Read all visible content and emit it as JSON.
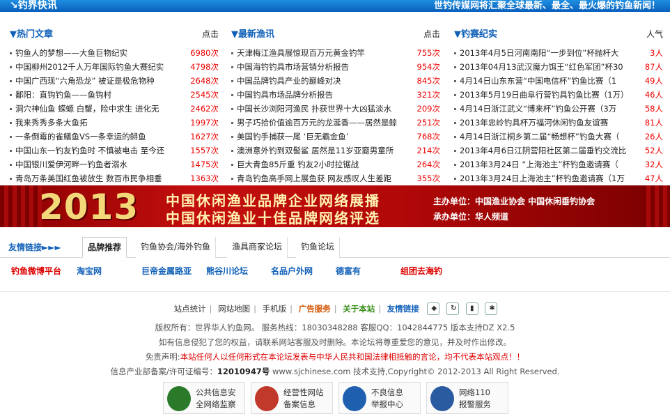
{
  "topbar": {
    "title": "↘钓界快讯",
    "slogan": "世钓传媒网将汇聚全球最新、最全、最火爆的钓鱼新闻！"
  },
  "cols": [
    {
      "heading": "▼热门文章",
      "count_label": "点击",
      "items": [
        {
          "t": "钓鱼人的梦想——大鱼巨物纪实",
          "n": "6980次"
        },
        {
          "t": "中国柳州2012千人万年国际钓鱼大赛纪实",
          "n": "4798次"
        },
        {
          "t": "中国广西现“六角恐龙” 被证是极危物种",
          "n": "2648次"
        },
        {
          "t": "鄱阳：直钩钓鱼——鱼钩村",
          "n": "2545次"
        },
        {
          "t": "洞穴神仙鱼 蝾螈 白蟹，险中求生 进化无",
          "n": "2462次"
        },
        {
          "t": "我来秀秀多条大鱼拓",
          "n": "1997次"
        },
        {
          "t": "一条倒霉的雀鳝鱼VS一条幸运的鲟鱼",
          "n": "1627次"
        },
        {
          "t": "中国山东一钓友钓鱼时 不慎被电击 至今还",
          "n": "1557次"
        },
        {
          "t": "中国银川爱伊河畔一钓鱼者溺水",
          "n": "1475次"
        },
        {
          "t": "青岛万条美国红鱼被放生 数百市民争相垂",
          "n": "1363次"
        }
      ]
    },
    {
      "heading": "▼最新渔讯",
      "count_label": "点击",
      "items": [
        {
          "t": "天津梅江渔具展惊现百万元黄金钓竿",
          "n": "755次"
        },
        {
          "t": "中国海钓钓具市场营销分析报告",
          "n": "954次"
        },
        {
          "t": "中国品牌钓具产业的巅峰对决",
          "n": "845次"
        },
        {
          "t": "中国钓具市场品牌分析报告",
          "n": "321次"
        },
        {
          "t": "中国长沙浏阳河渔民 扑获世界十大凶猛淡水",
          "n": "209次"
        },
        {
          "t": "男子巧拾价值逾百万元的龙涎香——居然是鲸",
          "n": "251次"
        },
        {
          "t": "美国钓手捕获一尾 ‘巨无霸金鱼’",
          "n": "768次"
        },
        {
          "t": "澳洲意外钓到双髻鲨 居然是11岁亚裔男童所",
          "n": "214次"
        },
        {
          "t": "巨大青鱼85斤重 钓友2小时拉锯战",
          "n": "264次"
        },
        {
          "t": "青岛钓鱼高手网上展鱼获 网友感叹人生差距",
          "n": "355次"
        }
      ]
    },
    {
      "heading": "▼钓赛纪实",
      "count_label": "人气",
      "items": [
        {
          "t": "2013年4月5日河南南阳“一步到位”杯抛杆大",
          "n": "3人"
        },
        {
          "t": "2013年04月13武汉魔力饵王“红色军团”杯30",
          "n": "87人"
        },
        {
          "t": "4月14日山东东营“中国电信杯”钓鱼比赛（1",
          "n": "49人"
        },
        {
          "t": "2013年5月19日曲阜行营钓具钓鱼比赛（1万）",
          "n": "46人"
        },
        {
          "t": "4月14日浙江武义“博来杯”钓鱼公开赛（3万",
          "n": "58人"
        },
        {
          "t": "2013年忠岭钓具杯万福河休闲钓鱼友谊赛",
          "n": "81人"
        },
        {
          "t": "4月14日浙江桐乡第二届“畅想杯”钓鱼大赛（",
          "n": "26人"
        },
        {
          "t": "2013年4月6日江阴营阳社区第二届垂钓交流比",
          "n": "52人"
        },
        {
          "t": "2013年3月24日 “上海池主”杯钓鱼邀请赛（",
          "n": "32人"
        },
        {
          "t": "2013年3月24日上海池主”杯钓鱼邀请赛（1万",
          "n": "47人"
        }
      ]
    }
  ],
  "banner": {
    "year": "2013",
    "line1": "中国休闲渔业品牌企业网络展播",
    "line2": "中国休闲渔业十佳品牌网络评选",
    "sponsor1": "主办单位：中国渔业协会  中国休闲垂钓协会",
    "sponsor2": "承办单位：华人频道"
  },
  "tabs": {
    "lead": "友情链接►►►",
    "items": [
      "品牌推荐",
      "钓鱼协会/海外钓鱼",
      "渔具商家论坛",
      "钓鱼论坛"
    ]
  },
  "links": [
    "钓鱼微博平台",
    "淘宝网",
    "巨帝金属路亚",
    "熊谷川论坛",
    "名品户外网",
    "德富有",
    "组团去海钓"
  ],
  "footer": {
    "nav": [
      "站点统计",
      "网站地图",
      "手机版",
      "广告服务",
      "关于本站",
      "友情链接"
    ],
    "copyright": "版权所有：世界华人钓鱼网。 服务热线：18030348288 客服QQ：1042844775 版本支持DZ X2.5",
    "notice": "如有信息侵犯了您的权益，请联系网站客服及时删除。本论坛将尊重爱您的意见，并及时作出修改。",
    "disclaimer_label": "免责声明:",
    "disclaimer": "本站任何人以任何形式在本论坛发表与中华人民共和国法律相抵触的言论，均不代表本站观点！！",
    "icp_label": "信息产业部备案/许可证编号：",
    "icp": "12010947号",
    "icp_tail": " www.sjchinese.com 技术支持,Copyright© 2012-2013 All Right Reserved."
  },
  "badges": [
    {
      "l1": "公共信息安",
      "l2": "全网络监察",
      "color": "#2a7a2a"
    },
    {
      "l1": "经营性网站",
      "l2": "备案信息",
      "color": "#c0392b"
    },
    {
      "l1": "不良信息",
      "l2": "举报中心",
      "color": "#1f5fb0"
    },
    {
      "l1": "网络110",
      "l2": "报警服务",
      "color": "#2a5aa0"
    }
  ]
}
